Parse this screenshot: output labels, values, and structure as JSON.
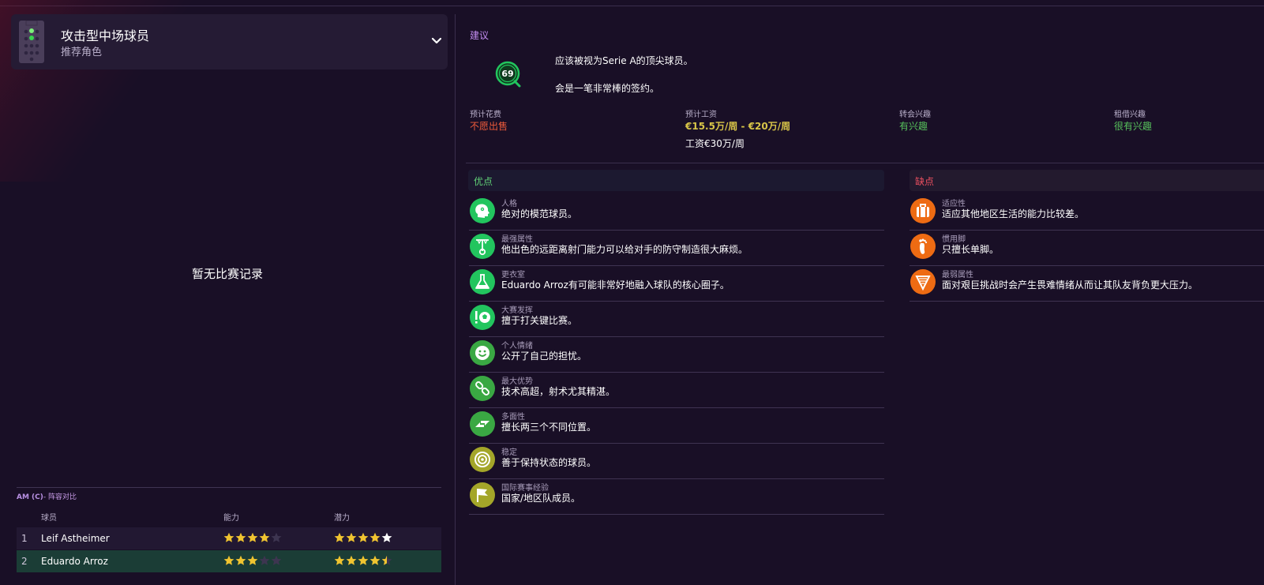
{
  "role": {
    "title": "攻击型中场球员",
    "subtitle": "推荐角色",
    "icon": "pitch-position-icon"
  },
  "match_history": {
    "empty_text": "暂无比赛记录"
  },
  "comparison": {
    "position": "AM (C)",
    "title": "- 阵容对比",
    "columns": {
      "player": "球员",
      "ability": "能力",
      "potential": "潜力"
    },
    "rows": [
      {
        "num": "1",
        "name": "Leif Astheimer",
        "ability": 4,
        "potential": 5,
        "potential_white_last": true
      },
      {
        "num": "2",
        "name": "Eduardo Arroz",
        "ability": 3,
        "potential": 4.5,
        "potential_white_last": false
      }
    ]
  },
  "advice": {
    "label": "建议",
    "badge_value": "69",
    "line1": "应该被视为Serie A的顶尖球员。",
    "line2": "会是一笔非常棒的签约。"
  },
  "stats": {
    "fee": {
      "label": "预计花费",
      "value": "不愿出售"
    },
    "wage": {
      "label": "预计工资",
      "low": "€15.5",
      "unit": "万/周",
      "dash": " - ",
      "high": "€20",
      "extra": "工资€30万/周"
    },
    "transfer": {
      "label": "转会兴趣",
      "value": "有兴趣"
    },
    "loan": {
      "label": "租借兴趣",
      "value": "很有兴趣"
    }
  },
  "pros": {
    "label": "优点",
    "items": [
      {
        "cat": "人格",
        "text": "绝对的模范球员。",
        "icon": "head-icon"
      },
      {
        "cat": "最强属性",
        "text": "他出色的远距离射门能力可以给对手的防守制造很大麻烦。",
        "icon": "shooting-target-icon"
      },
      {
        "cat": "更衣室",
        "text": "Eduardo Arroz有可能非常好地融入球队的核心圈子。",
        "icon": "flask-icon"
      },
      {
        "cat": "大赛发挥",
        "text": "擅于打关键比赛。",
        "icon": "ball-exclamation-icon"
      },
      {
        "cat": "个人情绪",
        "text": "公开了自己的担忧。",
        "icon": "smiley-icon"
      },
      {
        "cat": "最大优势",
        "text": "技术高超，射术尤其精湛。",
        "icon": "chain-icon"
      },
      {
        "cat": "多面性",
        "text": "擅长两三个不同位置。",
        "icon": "arrows-icon"
      },
      {
        "cat": "稳定",
        "text": "善于保持状态的球员。",
        "icon": "bullseye-icon"
      },
      {
        "cat": "国际赛事经验",
        "text": "国家/地区队成员。",
        "icon": "flag-icon"
      }
    ]
  },
  "cons": {
    "label": "缺点",
    "items": [
      {
        "cat": "适应性",
        "text": "适应其他地区生活的能力比较差。",
        "icon": "suitcase-icon"
      },
      {
        "cat": "惯用脚",
        "text": "只擅长单脚。",
        "icon": "foot-icon"
      },
      {
        "cat": "最弱属性",
        "text": "面对艰巨挑战时会产生畏难情绪从而让其队友背负更大压力。",
        "icon": "shield-icon"
      }
    ]
  },
  "colors": {
    "bg": "#190f26",
    "accent_purple": "#c28cf0",
    "good_green": "#57c25c",
    "bad_red": "#ec5a3a",
    "star_gold": "#f0c430",
    "pro_icon_green": "#22c55e",
    "pro_icon_olive": "#a4a629",
    "con_icon_orange": "#ee6b13"
  }
}
